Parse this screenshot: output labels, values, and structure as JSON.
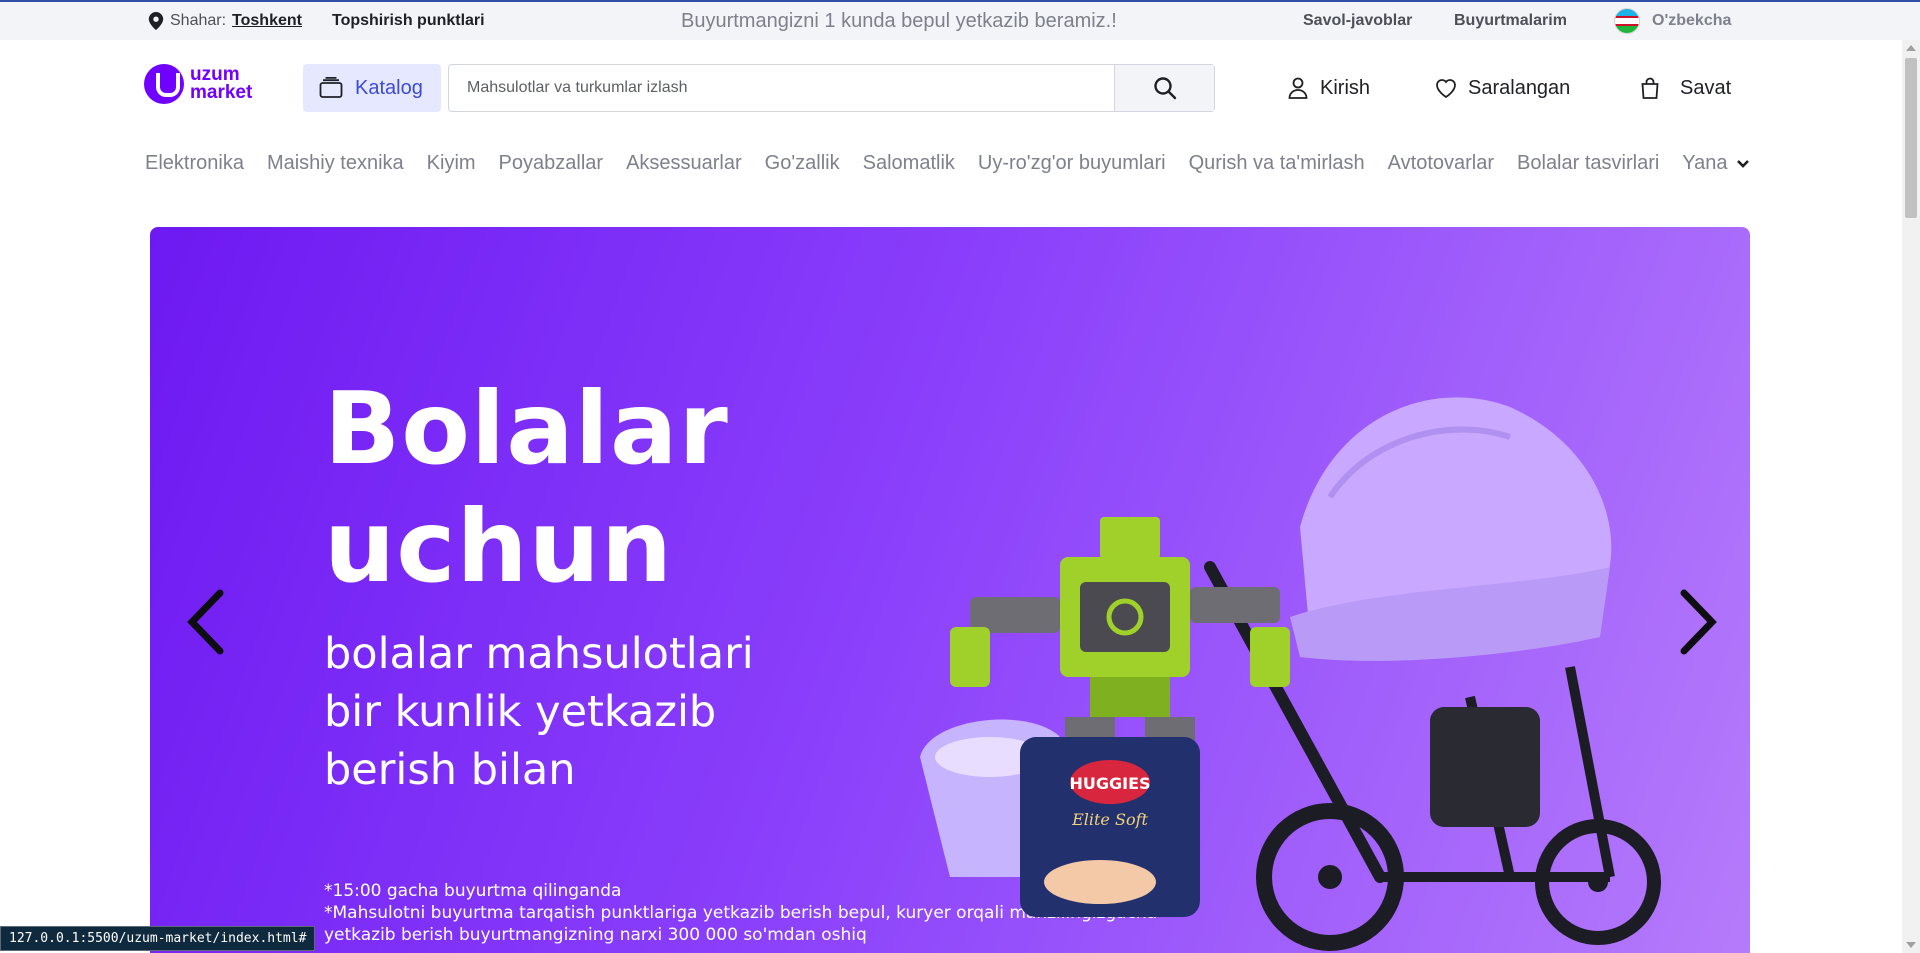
{
  "topbar": {
    "city_label": "Shahar:",
    "city_name": "Toshkent",
    "pickup_points": "Topshirish punktlari",
    "promo": "Buyurtmangizni 1 kunda bepul yetkazib beramiz.!",
    "faq": "Savol-javoblar",
    "my_orders": "Buyurtmalarim",
    "language": "O'zbekcha"
  },
  "header": {
    "logo_line1": "uzum",
    "logo_line2": "market",
    "catalog": "Katalog",
    "search_placeholder": "Mahsulotlar va turkumlar izlash",
    "login": "Kirish",
    "favorites": "Saralangan",
    "cart": "Savat"
  },
  "categories": [
    "Elektronika",
    "Maishiy texnika",
    "Kiyim",
    "Poyabzallar",
    "Aksessuarlar",
    "Go'zallik",
    "Salomatlik",
    "Uy-ro'zg'or buyumlari",
    "Qurish va ta'mirlash",
    "Avtotovarlar",
    "Bolalar tasvirlari"
  ],
  "more_label": "Yana",
  "banner": {
    "title_line1": "Bolalar",
    "title_line2": "uchun",
    "subtitle_line1": "bolalar mahsulotlari",
    "subtitle_line2": "bir kunlik yetkazib",
    "subtitle_line3": "berish bilan",
    "note_line1": "*15:00 gacha buyurtma qilinganda",
    "note_line2": "*Mahsulotni buyurtma tarqatish punktlariga yetkazib berish bepul, kuryer orqali manzilingizgacha yetkazib berish buyurtmangizning narxi 300 000 so'mdan oshiq",
    "art_brand": "HUGGIES",
    "art_sub": "Elite Soft"
  },
  "status_url": "127.0.0.1:5500/uzum-market/index.html#",
  "colors": {
    "brand": "#7000ff",
    "catalog_bg": "#e6e8ff",
    "catalog_text": "#3d4bd4",
    "banner_start": "#6d19f2",
    "banner_end": "#b57bfb"
  }
}
